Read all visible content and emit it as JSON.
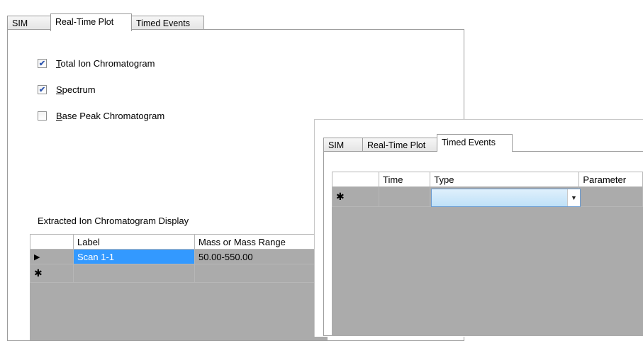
{
  "back_window": {
    "tabs": [
      {
        "label": "SIM"
      },
      {
        "label": "Real-Time Plot",
        "active": true
      },
      {
        "label": "Timed Events"
      }
    ],
    "checkboxes": [
      {
        "accel": "T",
        "rest": "otal Ion Chromatogram",
        "checked": true
      },
      {
        "accel": "S",
        "rest": "pectrum",
        "checked": true
      },
      {
        "accel": "B",
        "rest": "ase Peak Chromatogram",
        "checked": false
      }
    ],
    "eic_label": "Extracted Ion Chromatogram Display",
    "eic_table": {
      "columns": [
        "Label",
        "Mass or Mass Range"
      ],
      "rows": [
        {
          "marker": "▶",
          "label": "Scan 1-1",
          "mass": "50.00-550.00"
        },
        {
          "marker": "✱",
          "label": "",
          "mass": ""
        }
      ]
    }
  },
  "front_window": {
    "tabs": [
      {
        "label": "SIM"
      },
      {
        "label": "Real-Time Plot"
      },
      {
        "label": "Timed Events",
        "active": true
      }
    ],
    "table": {
      "columns": [
        "Time",
        "Type",
        "Parameter"
      ],
      "rows": [
        {
          "marker": "✱",
          "time": "",
          "type": "",
          "parameter": ""
        }
      ]
    },
    "dropdown_icon": "chevron-down-icon"
  },
  "colors": {
    "selection": "#3399ff",
    "grid_empty": "#ababab",
    "dropdown": "#cde8fa"
  }
}
